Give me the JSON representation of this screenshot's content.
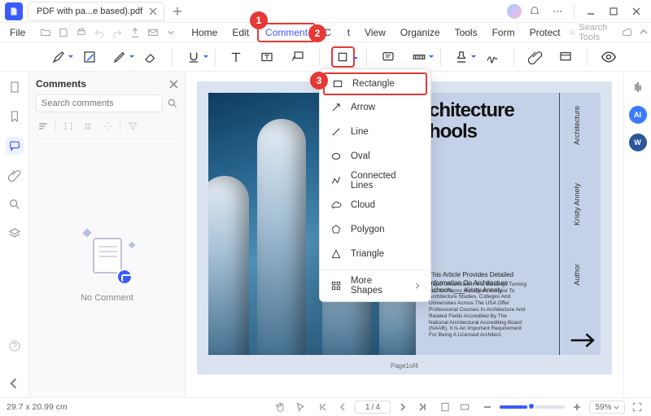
{
  "titlebar": {
    "tab_title": "PDF with pa...e based).pdf"
  },
  "menubar": {
    "file": "File",
    "items": [
      "Home",
      "Edit",
      "Comment",
      "C",
      "t",
      "View",
      "Organize",
      "Tools",
      "Form",
      "Protect"
    ],
    "search_placeholder": "Search Tools"
  },
  "callouts": {
    "one": "1",
    "two": "2",
    "three": "3"
  },
  "shapes_menu": {
    "rectangle": "Rectangle",
    "arrow": "Arrow",
    "line": "Line",
    "oval": "Oval",
    "connected": "Connected Lines",
    "cloud": "Cloud",
    "polygon": "Polygon",
    "triangle": "Triangle",
    "more": "More Shapes"
  },
  "comments": {
    "title": "Comments",
    "search_placeholder": "Search comments",
    "empty": "No Comment"
  },
  "page": {
    "title_line1": "chitecture",
    "title_line2": "hools",
    "v_architecture": "Architecture",
    "v_author_name": "Kristy Annely",
    "v_author": "Author",
    "subtitle": "This Article Provides Detailed Information On Architecture Schools.___Kristy Annely",
    "paragraph": "Rapid Urbanization And Buildings Turning Into Art Forms Has Given A Boost To Architecture Studies. Colleges And Universities Across The USA Offer Professional Courses In Architecture And Related Fields Accredited By The National Architectural Accrediting Board (NAAB). It Is An Important Requirement For Being A Licensed Architect.",
    "page_number_label": "Page1of4"
  },
  "status": {
    "dimensions": "29.7 x 20.99 cm",
    "page_current": "1",
    "page_total": "4",
    "zoom": "59%"
  }
}
